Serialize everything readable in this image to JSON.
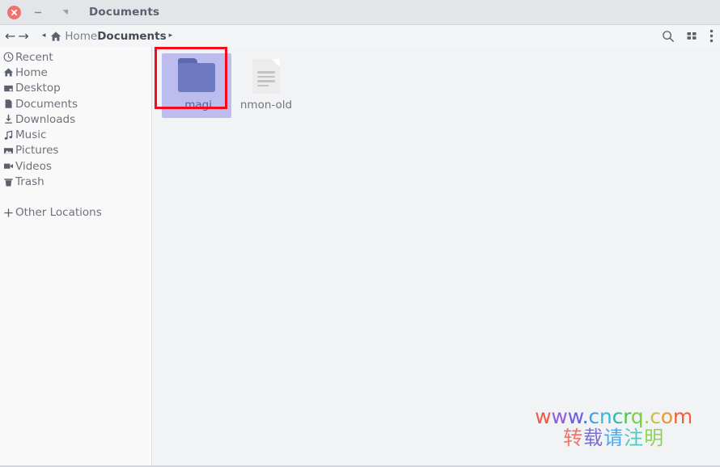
{
  "window": {
    "title": "Documents",
    "controls": {
      "close": "✕",
      "minimize": "–",
      "maximize": "❐"
    }
  },
  "pathbar": {
    "back": "←",
    "forward": "→",
    "chevron_left": "◂",
    "chevron_right": "▸",
    "home_label": "Home",
    "current_label": "Documents",
    "tools": {
      "search": "search-icon",
      "view_grid": "grid-view-icon",
      "menu": "overflow-menu-icon"
    }
  },
  "sidebar": {
    "items": [
      {
        "label": "Recent",
        "icon": "clock-icon"
      },
      {
        "label": "Home",
        "icon": "home-icon"
      },
      {
        "label": "Desktop",
        "icon": "desktop-icon"
      },
      {
        "label": "Documents",
        "icon": "document-icon"
      },
      {
        "label": "Downloads",
        "icon": "download-icon"
      },
      {
        "label": "Music",
        "icon": "music-note-icon"
      },
      {
        "label": "Pictures",
        "icon": "image-icon"
      },
      {
        "label": "Videos",
        "icon": "video-camera-icon"
      },
      {
        "label": "Trash",
        "icon": "trash-icon"
      },
      {
        "label": "Other Locations",
        "icon": "plus-icon"
      }
    ]
  },
  "content": {
    "items": [
      {
        "name": ".magi",
        "type": "folder",
        "selected": true
      },
      {
        "name": "nmon-old",
        "type": "file",
        "selected": false
      }
    ],
    "selection_color": "#bcbcee",
    "annotation_color": "#f60a1e",
    "folder_color": "#6d79c0",
    "folder_tab_color": "#5c69ad"
  },
  "watermark": {
    "line1": [
      {
        "ch": "w",
        "color": "#ef5b4c"
      },
      {
        "ch": "w",
        "color": "#8f5fd8"
      },
      {
        "ch": "w",
        "color": "#6a5fe0"
      },
      {
        "ch": ".",
        "color": "#3f74e8"
      },
      {
        "ch": "c",
        "color": "#3aa0e8"
      },
      {
        "ch": "n",
        "color": "#35b9df"
      },
      {
        "ch": "c",
        "color": "#2fb7a6"
      },
      {
        "ch": "r",
        "color": "#4cc44e"
      },
      {
        "ch": "q",
        "color": "#79cf4a"
      },
      {
        "ch": ".",
        "color": "#a9d04a"
      },
      {
        "ch": "c",
        "color": "#c9bf44"
      },
      {
        "ch": "o",
        "color": "#e09a3b"
      },
      {
        "ch": "m",
        "color": "#ee5f3c"
      }
    ],
    "line2": [
      {
        "ch": "转",
        "color": "#f0756a"
      },
      {
        "ch": "载",
        "color": "#7b6fd6"
      },
      {
        "ch": "请",
        "color": "#4aa8ef"
      },
      {
        "ch": "注",
        "color": "#4fc9c0"
      },
      {
        "ch": "明",
        "color": "#8ed25a"
      }
    ]
  }
}
